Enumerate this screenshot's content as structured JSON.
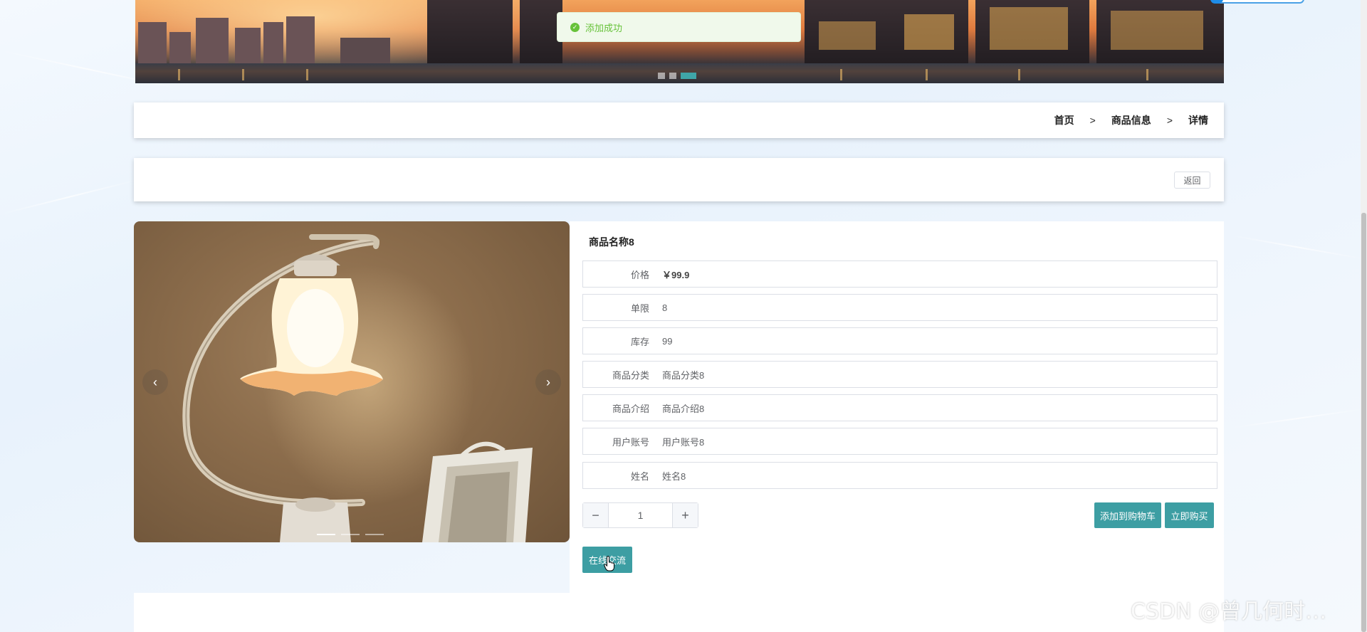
{
  "toast": {
    "message": "添加成功",
    "icon": "success-check-icon"
  },
  "breadcrumb": {
    "home": "首页",
    "separator": ">",
    "category": "商品信息",
    "current": "详情"
  },
  "back_button": {
    "label": "返回"
  },
  "carousel": {
    "prev_glyph": "‹",
    "next_glyph": "›",
    "image_description_icon": "lamp-photo"
  },
  "product": {
    "title": "商品名称8",
    "fields": [
      {
        "label": "价格",
        "value": "￥99.9"
      },
      {
        "label": "单限",
        "value": "8"
      },
      {
        "label": "库存",
        "value": "99"
      },
      {
        "label": "商品分类",
        "value": "商品分类8"
      },
      {
        "label": "商品介绍",
        "value": "商品介绍8"
      },
      {
        "label": "用户账号",
        "value": "用户账号8"
      },
      {
        "label": "姓名",
        "value": "姓名8"
      }
    ]
  },
  "quantity": {
    "minus": "−",
    "value": "1",
    "plus": "+"
  },
  "actions": {
    "add_to_cart": "添加到购物车",
    "buy_now": "立即购买",
    "online_chat": "在线交流"
  },
  "watermark": "CSDN @曾几何时…",
  "colors": {
    "accent": "#3d9ea3",
    "success": "#67c23a",
    "border": "#dcdfe6"
  }
}
